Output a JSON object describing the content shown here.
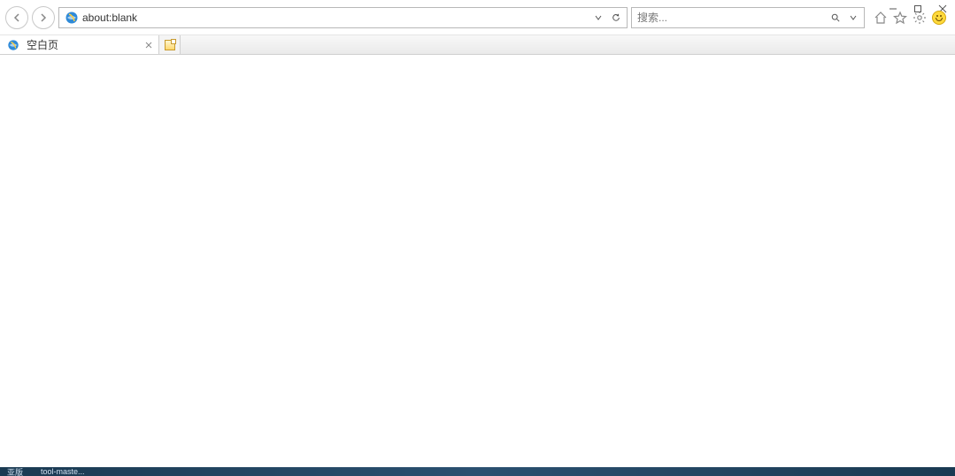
{
  "window": {
    "minimize_tooltip": "Minimize",
    "maximize_tooltip": "Maximize",
    "close_tooltip": "Close"
  },
  "toolbar": {
    "back_tooltip": "Back",
    "forward_tooltip": "Forward",
    "address_value": "about:blank",
    "dropdown_tooltip": "Show history",
    "refresh_tooltip": "Refresh",
    "search_placeholder": "搜索...",
    "search_button_tooltip": "Search",
    "search_dropdown_tooltip": "Search options",
    "home_tooltip": "Home",
    "favorites_tooltip": "Favorites",
    "tools_tooltip": "Tools",
    "feedback_tooltip": "Feedback"
  },
  "tabs": [
    {
      "title": "空白页"
    }
  ],
  "new_tab_tooltip": "New tab",
  "taskbar": {
    "item1": "亚版",
    "item2": "tool-maste..."
  }
}
